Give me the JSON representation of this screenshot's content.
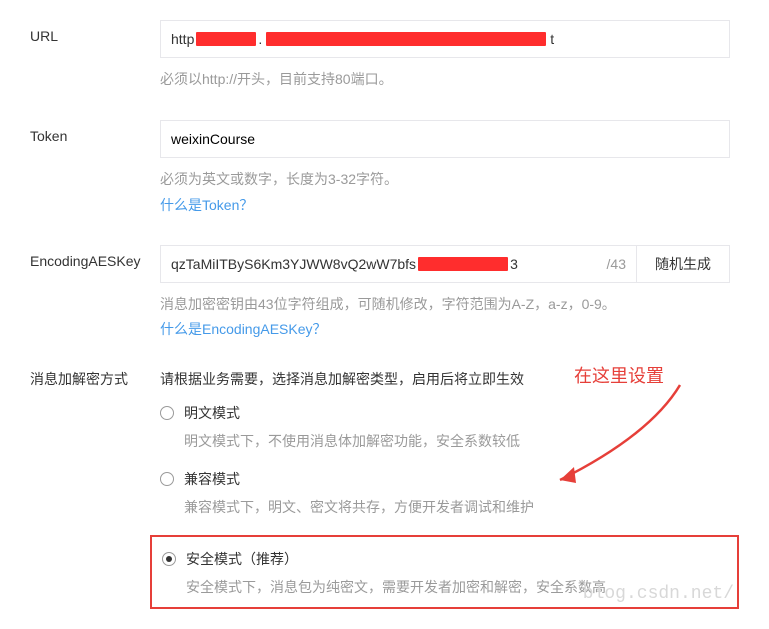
{
  "url": {
    "label": "URL",
    "value_prefix": "http",
    "value_suffix": "t",
    "help": "必须以http://开头，目前支持80端口。"
  },
  "token": {
    "label": "Token",
    "value": "weixinCourse",
    "help": "必须为英文或数字，长度为3-32字符。",
    "link": "什么是Token？"
  },
  "aeskey": {
    "label": "EncodingAESKey",
    "value_prefix": "qzTaMiITByS6Km3YJWW8vQ2wW7bfs",
    "value_suffix": "3",
    "counter": "/43",
    "button": "随机生成",
    "help": "消息加密密钥由43位字符组成，可随机修改，字符范围为A-Z，a-z，0-9。",
    "link": "什么是EncodingAESKey？"
  },
  "mode": {
    "label": "消息加解密方式",
    "intro": "请根据业务需要，选择消息加解密类型，启用后将立即生效",
    "options": [
      {
        "label": "明文模式",
        "desc": "明文模式下，不使用消息体加解密功能，安全系数较低"
      },
      {
        "label": "兼容模式",
        "desc": "兼容模式下，明文、密文将共存，方便开发者调试和维护"
      },
      {
        "label": "安全模式（推荐）",
        "desc": "安全模式下，消息包为纯密文，需要开发者加密和解密，安全系数高"
      }
    ]
  },
  "annotation": "在这里设置",
  "watermark": "blog.csdn.net/"
}
